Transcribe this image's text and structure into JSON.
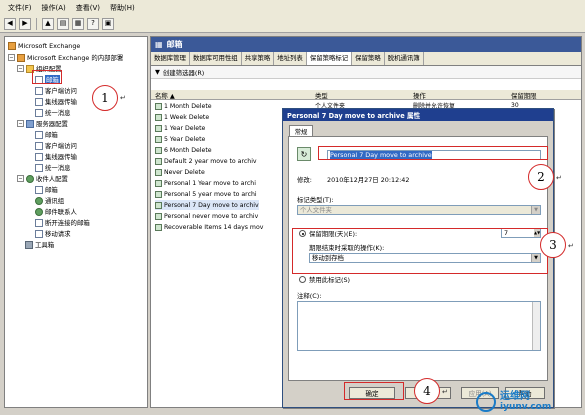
{
  "menu": [
    "文件(F)",
    "操作(A)",
    "查看(V)",
    "帮助(H)"
  ],
  "toolbar_buttons": [
    "back-icon",
    "forward-icon",
    "up-icon",
    "show-hide-tree-icon",
    "properties-icon",
    "help-icon",
    "console-icon"
  ],
  "tree": {
    "items": [
      {
        "label": "Microsoft Exchange",
        "icon": "exchange-icon",
        "level": 0,
        "expander": ""
      },
      {
        "label": "Microsoft Exchange 的内部部署",
        "icon": "exchange-icon",
        "level": 1,
        "expander": "−"
      },
      {
        "label": "组织配置",
        "icon": "org-icon",
        "level": 2,
        "expander": "−"
      },
      {
        "label": "邮箱",
        "icon": "mailbox-icon",
        "level": 3,
        "expander": ""
      },
      {
        "label": "客户端访问",
        "icon": "client-access-icon",
        "level": 3,
        "expander": ""
      },
      {
        "label": "集线器传输",
        "icon": "hub-transport-icon",
        "level": 3,
        "expander": ""
      },
      {
        "label": "统一消息",
        "icon": "unified-messaging-icon",
        "level": 3,
        "expander": ""
      },
      {
        "label": "服务器配置",
        "icon": "server-icon",
        "level": 2,
        "expander": "−"
      },
      {
        "label": "邮箱",
        "icon": "mailbox-icon",
        "level": 3,
        "expander": ""
      },
      {
        "label": "客户端访问",
        "icon": "client-access-icon",
        "level": 3,
        "expander": ""
      },
      {
        "label": "集线器传输",
        "icon": "hub-transport-icon",
        "level": 3,
        "expander": ""
      },
      {
        "label": "统一消息",
        "icon": "unified-messaging-icon",
        "level": 3,
        "expander": ""
      },
      {
        "label": "收件人配置",
        "icon": "recipient-icon",
        "level": 2,
        "expander": "−"
      },
      {
        "label": "邮箱",
        "icon": "mailbox-icon",
        "level": 3,
        "expander": ""
      },
      {
        "label": "通讯组",
        "icon": "group-icon",
        "level": 3,
        "expander": ""
      },
      {
        "label": "邮件联系人",
        "icon": "contact-icon",
        "level": 3,
        "expander": ""
      },
      {
        "label": "断开连接的邮箱",
        "icon": "disconnected-mailbox-icon",
        "level": 3,
        "expander": ""
      },
      {
        "label": "移动请求",
        "icon": "move-request-icon",
        "level": 3,
        "expander": ""
      },
      {
        "label": "工具箱",
        "icon": "toolbox-icon",
        "level": 1,
        "expander": ""
      }
    ]
  },
  "main": {
    "title": "邮箱",
    "tabs": [
      "数据库管理",
      "数据库可用性组",
      "共享策略",
      "地址列表",
      "保留策略标记",
      "保留策略",
      "脱机通讯簿"
    ],
    "active_tab": 4,
    "action": "创建筛选器(R)",
    "columns": [
      "名称 ▲",
      "类型",
      "操作",
      "保留期限"
    ],
    "partial_row": {
      "type": "个人文件夹",
      "action": "删除并允许恢复",
      "period": "30"
    },
    "rows": [
      "1 Month Delete",
      "1 Week Delete",
      "1 Year Delete",
      "5 Year Delete",
      "6 Month Delete",
      "Default 2 year move to archiv",
      "Never Delete",
      "Personal 1 Year move to archi",
      "Personal 5 year move to archi",
      "Personal 7 Day move to archiv",
      "Personal never move to archiv",
      "Recoverable Items 14 days mov"
    ],
    "selected_row": 9
  },
  "dialog": {
    "title": "Personal 7 Day move to archive 属性",
    "tab": "常规",
    "name_value": "Personal 7 Day move to archive",
    "modified_label": "修改:",
    "modified_value": "2010年12月27日 20:12:42",
    "tag_type_label": "标记类型(T):",
    "tag_type_value": "个人文件夹",
    "retention_label": "保留期限(天)(E):",
    "retention_value": "7",
    "action_label": "期限结束时采取的操作(K):",
    "action_value": "移动到存档",
    "disable_label": "禁用此标记(S)",
    "comment_label": "注释(C):",
    "ok": "确定",
    "cancel": "取消",
    "apply": "应用(A)",
    "help": "帮助"
  },
  "callouts": [
    "1",
    "2",
    "3",
    "4"
  ],
  "callout_mark": "↵",
  "watermark": {
    "cn": "运维网",
    "url": "iyunv.com"
  },
  "colors": {
    "callout": "#d42a2a",
    "title_bar": "#1f3f8f",
    "header": "#3b5998",
    "selection": "#316ac5"
  }
}
